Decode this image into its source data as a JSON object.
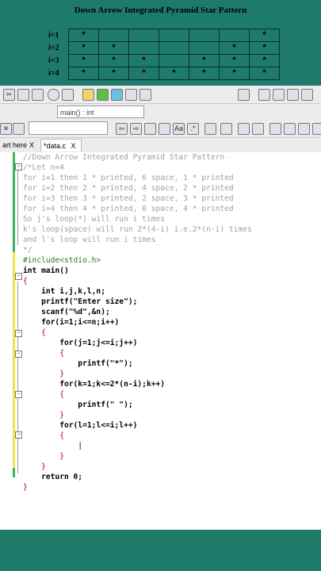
{
  "slide": {
    "title": "Down Arrow Integrated Pyramid Star Pattern",
    "rows": [
      {
        "label": "i=1",
        "cells": [
          "*",
          "",
          "",
          "",
          "",
          "",
          "*"
        ]
      },
      {
        "label": "i=2",
        "cells": [
          "*",
          "*",
          "",
          "",
          "",
          "*",
          "*"
        ]
      },
      {
        "label": "i=3",
        "cells": [
          "*",
          "*",
          "*",
          "",
          "*",
          "*",
          "*"
        ]
      },
      {
        "label": "i=4",
        "cells": [
          "*",
          "*",
          "*",
          "*",
          "*",
          "*",
          "*"
        ]
      }
    ]
  },
  "ide": {
    "function_combo": "main() : int",
    "tabs": [
      "art here",
      "*data.c"
    ],
    "tab_close": "X",
    "search_glyph": ".*",
    "code_lines": [
      "//Down Arrow Integrated Pyramid Star Pattern",
      "/*Let n=4",
      "for i=1 then 1 * printed, 6 space, 1 * printed",
      "for i=2 then 2 * printed, 4 space, 2 * printed",
      "for i=3 then 3 * printed, 2 space, 3 * printed",
      "for i=4 then 4 * printed, 0 space, 4 * printed",
      "So j's loop(*) will run i times",
      "k's loop(space) will run 2*(4-i) i.e.2*(n-i) times",
      "and l's loop will run i times",
      "*/",
      "#include<stdio.h>",
      "int main()",
      "{",
      "    int i,j,k,l,n;",
      "    printf(\"Enter size\");",
      "    scanf(\"%d\",&n);",
      "    for(i=1;i<=n;i++)",
      "    {",
      "        for(j=1;j<=i;j++)",
      "        {",
      "            printf(\"*\");",
      "        }",
      "        for(k=1;k<=2*(n-i);k++)",
      "        {",
      "            printf(\" \");",
      "        }",
      "        for(l=1;l<=i;l++)",
      "        {",
      "            |",
      "        }",
      "    }",
      "    return 0;",
      "}"
    ]
  }
}
